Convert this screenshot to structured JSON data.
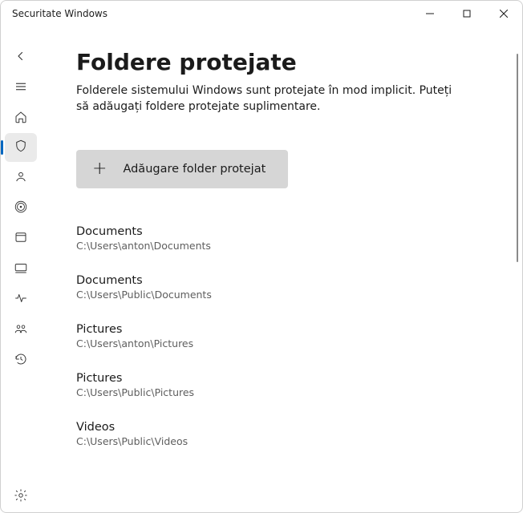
{
  "window": {
    "title": "Securitate Windows"
  },
  "sidebar": {
    "items": [
      {
        "id": "back"
      },
      {
        "id": "menu"
      },
      {
        "id": "home"
      },
      {
        "id": "shield",
        "selected": true
      },
      {
        "id": "account"
      },
      {
        "id": "firewall"
      },
      {
        "id": "app-browser"
      },
      {
        "id": "device-security"
      },
      {
        "id": "performance"
      },
      {
        "id": "family"
      },
      {
        "id": "history"
      }
    ],
    "settings_id": "settings"
  },
  "page": {
    "title": "Foldere protejate",
    "subtitle": "Folderele sistemului Windows sunt protejate în mod implicit. Puteți să adăugați foldere protejate suplimentare.",
    "add_button_label": "Adăugare folder protejat"
  },
  "folders": [
    {
      "name": "Documents",
      "path": "C:\\Users\\anton\\Documents"
    },
    {
      "name": "Documents",
      "path": "C:\\Users\\Public\\Documents"
    },
    {
      "name": "Pictures",
      "path": "C:\\Users\\anton\\Pictures"
    },
    {
      "name": "Pictures",
      "path": "C:\\Users\\Public\\Pictures"
    },
    {
      "name": "Videos",
      "path": "C:\\Users\\Public\\Videos"
    }
  ]
}
